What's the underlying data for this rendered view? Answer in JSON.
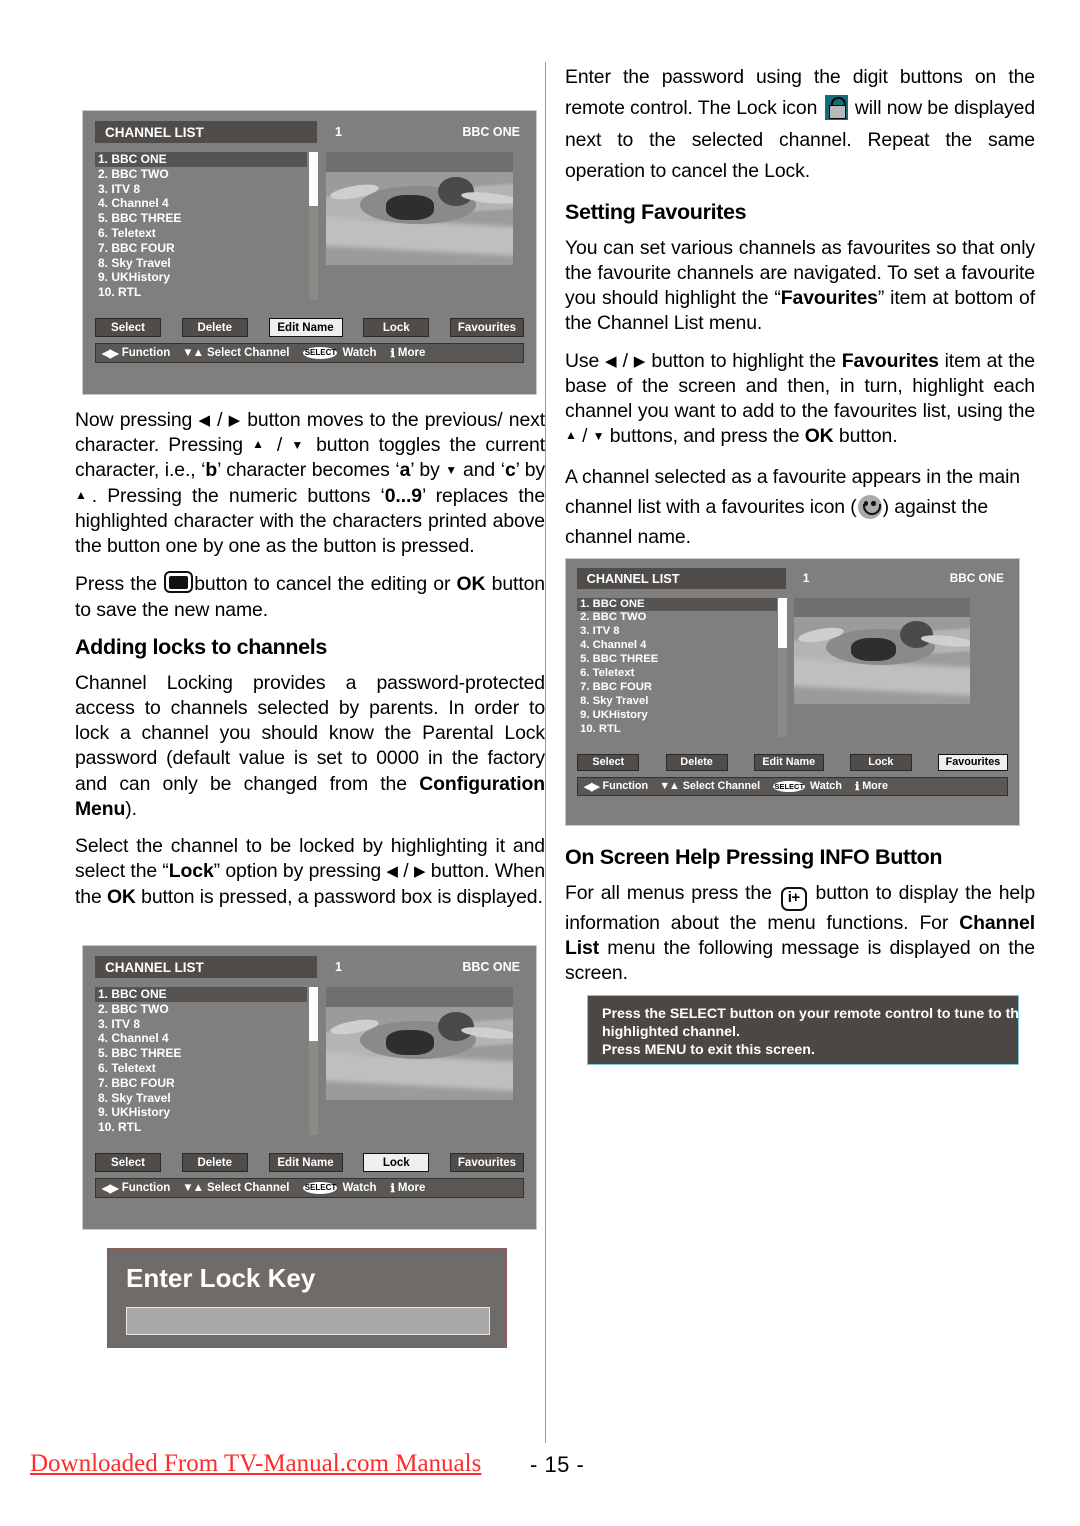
{
  "page": {
    "number": "- 15 -",
    "watermark": "Downloaded From TV-Manual.com Manuals"
  },
  "colors": {
    "osd_background": "#7f7f7f",
    "osd_titlebar": "#4f4c4a",
    "osd_button": "#4f4c4a",
    "osd_button_active": "#efefef",
    "lock_icon_teal": "#156b78",
    "help_box_border": "#7fc6e0",
    "watermark_red": "#ff2a2a"
  },
  "left_column": {
    "para_edit": {
      "s1": "Now  pressing ",
      "s2": " / ",
      "s3": " button moves to the previous/ next character. Pressing ",
      "s4": " / ",
      "s5": " button toggles the current character, i.e., ‘",
      "b1": "b",
      "s6": "’ character becomes ‘",
      "b2": "a",
      "s7": "’ by ",
      "s8": " and ‘",
      "b3": "c",
      "s9": "’ by ",
      "s10": ". Pressing the numeric buttons ‘",
      "b4": "0...9",
      "s11": "’ replaces the highlighted character with the characters printed above the button one by one as the button is pressed."
    },
    "para_cancel": {
      "s1": "Press the ",
      "s2": "button to cancel the editing or ",
      "b1": "OK",
      "s3": " button to save the new name."
    },
    "heading_locks": "Adding locks to channels",
    "para_locking": {
      "s1": "Channel Locking provides a password-protected access to channels selected by parents. In order to lock a channel you should know the Parental Lock password (default value is set to 0000 in the factory and can only be changed from the ",
      "b1": "Configuration Menu",
      "s2": ")."
    },
    "para_select_lock": {
      "s1": "Select the channel to be locked by highlighting it and select the “",
      "b1": "Lock",
      "s2": "” option by pressing ",
      "s3": " / ",
      "s4": " button. When the ",
      "b2": "OK",
      "s5": " button is pressed, a password box is displayed."
    },
    "lock_dialog": {
      "title": "Enter Lock Key",
      "value": ""
    }
  },
  "right_column": {
    "para_password": {
      "s1": "Enter the password using the digit buttons on the remote control. The Lock icon ",
      "s2": " will now be displayed next to the selected channel. Repeat the same operation to cancel the Lock."
    },
    "heading_favourites": "Setting Favourites",
    "para_fav_intro": {
      "s1": "You can set various channels as favourites so that only the favourite channels are navigated. To set a favourite you should highlight the “",
      "b1": "Favourites",
      "s2": "” item at bottom of the Channel List menu."
    },
    "para_fav_use": {
      "s1": "Use ",
      "s2": " / ",
      "s3": " button to highlight the ",
      "b1": "Favourites",
      "s4": " item at the base of the screen and then, in turn, highlight each channel you want to add to the favourites list, using the ",
      "s5": " / ",
      "s6": " buttons, and press the ",
      "b2": "OK",
      "s7": " button."
    },
    "para_fav_icon": {
      "s1": "A channel selected as a favourite appears in the main channel list with a favourites icon  (",
      "s2": ") against the channel name."
    },
    "heading_info": "On Screen Help Pressing INFO Button",
    "para_info": {
      "s1": "For all menus press the ",
      "icon": "i+",
      "s2": " button to display the help information about the menu functions. For ",
      "b1": "Channel List",
      "s3": " menu the following message is displayed on the screen."
    },
    "help_box": {
      "line1": "Press the SELECT button on your remote control to tune to the",
      "line2": "highlighted channel.",
      "line3": "Press MENU to exit this screen."
    }
  },
  "osd": {
    "title": "CHANNEL LIST",
    "channel_number": "1",
    "channel_name": "BBC ONE",
    "channels": [
      "1. BBC ONE",
      "2. BBC TWO",
      "3. ITV 8",
      "4. Channel 4",
      "5. BBC THREE",
      "6. Teletext",
      "7. BBC FOUR",
      "8. Sky Travel",
      "9. UKHistory",
      "10. RTL"
    ],
    "selected_channel_index": 0,
    "buttons": [
      "Select",
      "Delete",
      "Edit Name",
      "Lock",
      "Favourites"
    ],
    "status": {
      "function_label": "Function",
      "select_channel_label": "Select Channel",
      "select_pill": "SELECT",
      "watch_label": "Watch",
      "more_label": "More"
    },
    "screens": [
      {
        "id": "screen-edit-name",
        "active_button": "Edit Name"
      },
      {
        "id": "screen-lock",
        "active_button": "Lock"
      },
      {
        "id": "screen-favourites",
        "active_button": "Favourites"
      }
    ]
  }
}
